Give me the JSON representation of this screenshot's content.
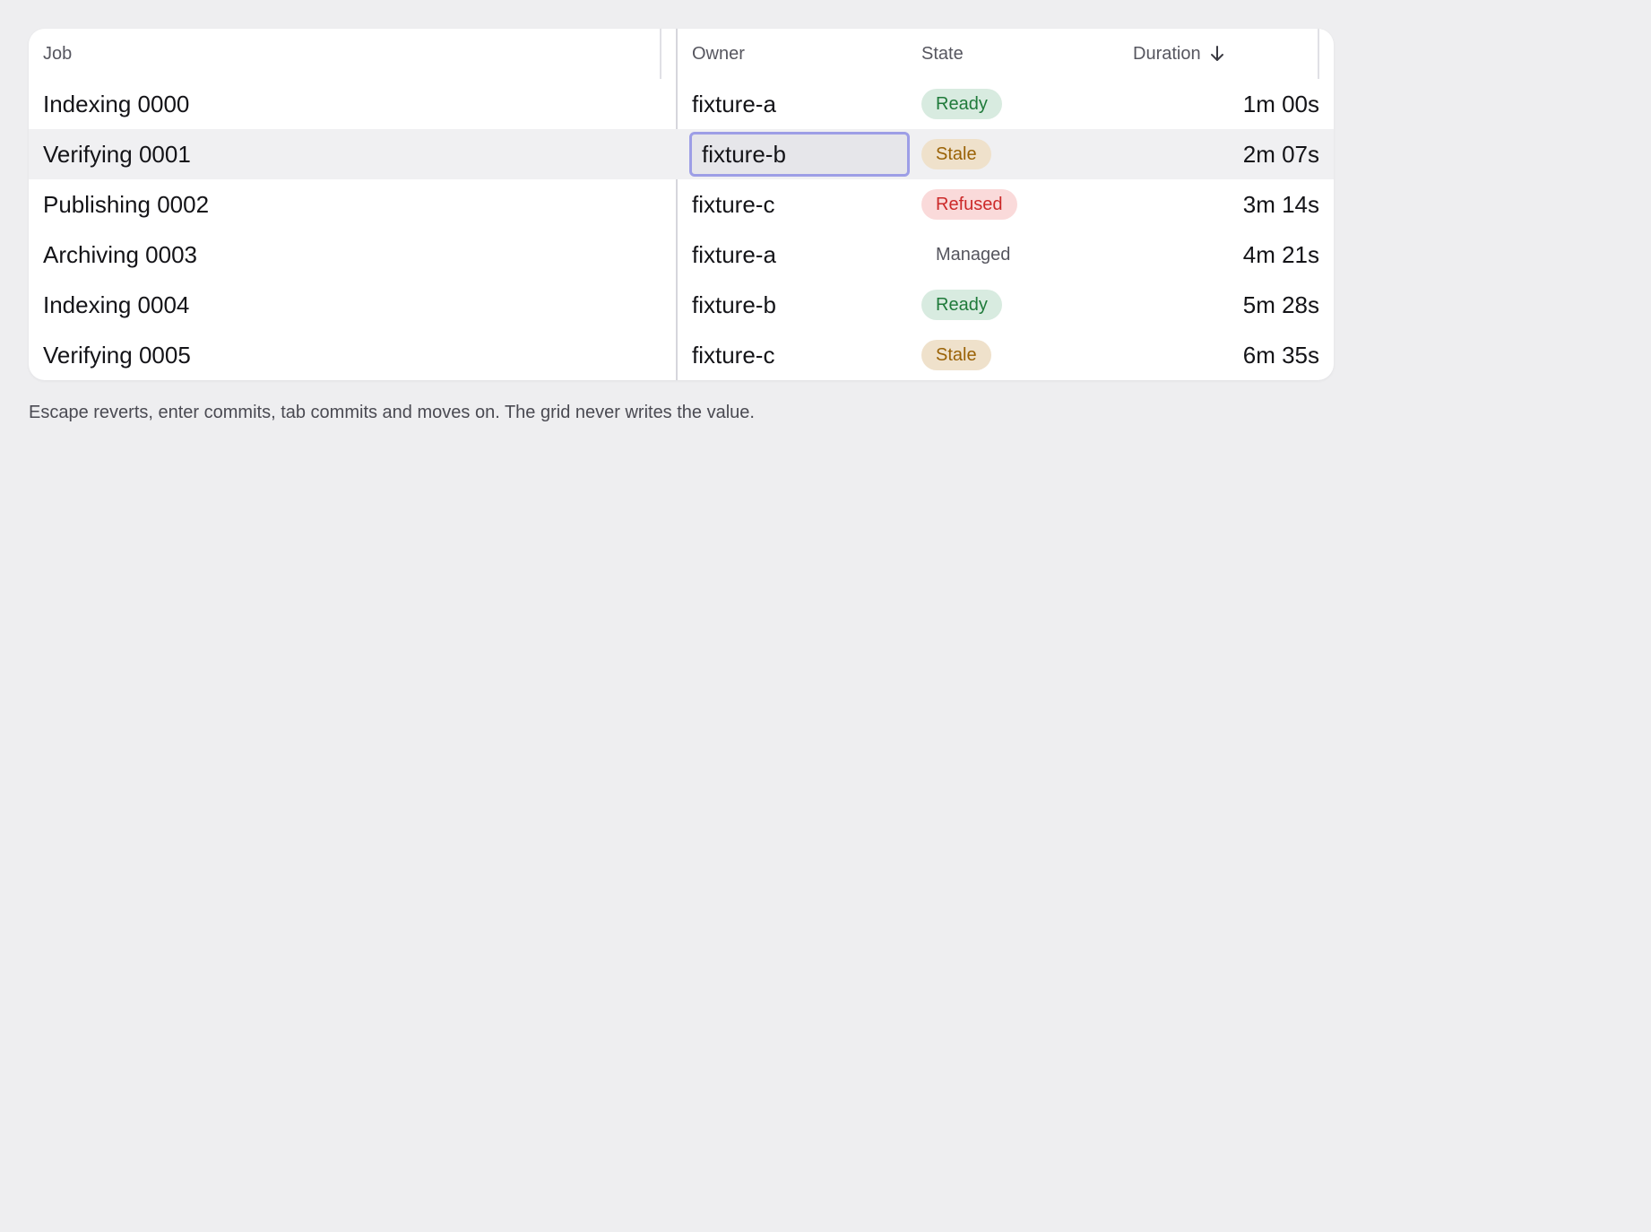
{
  "grid": {
    "columns": [
      {
        "key": "job",
        "label": "Job"
      },
      {
        "key": "owner",
        "label": "Owner"
      },
      {
        "key": "state",
        "label": "State"
      },
      {
        "key": "duration",
        "label": "Duration",
        "sort": "descending",
        "sort_icon": "arrow-down-icon"
      }
    ],
    "rows": [
      {
        "job": "Indexing 0000",
        "owner": "fixture-a",
        "state": "Ready",
        "duration": "1m 00s"
      },
      {
        "job": "Verifying 0001",
        "owner": "fixture-b",
        "state": "Stale",
        "duration": "2m 07s",
        "editing": "owner"
      },
      {
        "job": "Publishing 0002",
        "owner": "fixture-c",
        "state": "Refused",
        "duration": "3m 14s"
      },
      {
        "job": "Archiving 0003",
        "owner": "fixture-a",
        "state": "Managed",
        "duration": "4m 21s"
      },
      {
        "job": "Indexing 0004",
        "owner": "fixture-b",
        "state": "Ready",
        "duration": "5m 28s"
      },
      {
        "job": "Verifying 0005",
        "owner": "fixture-c",
        "state": "Stale",
        "duration": "6m 35s"
      }
    ],
    "editor": {
      "value": "fixture-b"
    }
  },
  "state_colors": {
    "Ready": {
      "bg": "#d8ebe0",
      "fg": "#1f7a3a"
    },
    "Stale": {
      "bg": "#efe1cb",
      "fg": "#9a6206"
    },
    "Refused": {
      "bg": "#fadada",
      "fg": "#cc2a2a"
    },
    "Managed": {
      "bg": "transparent",
      "fg": "#55555e"
    }
  },
  "accent_color": "#9d9ee6",
  "hint": "Escape reverts, enter commits, tab commits and moves on. The grid never writes the value."
}
